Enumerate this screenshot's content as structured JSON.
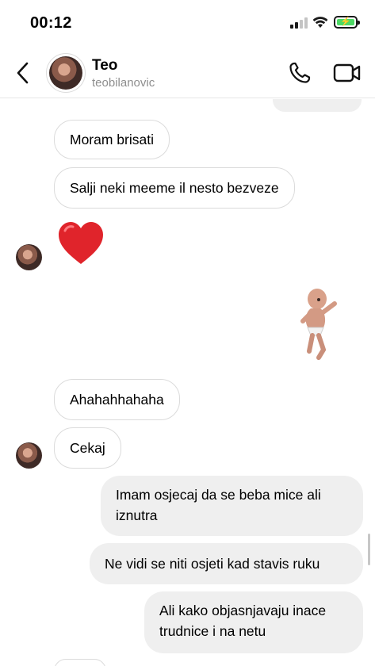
{
  "status_bar": {
    "time": "00:12"
  },
  "header": {
    "name": "Teo",
    "username": "teobilanovic"
  },
  "messages": {
    "m1": "Moram brisati",
    "m2": "Salji neki meeme il nesto bezveze",
    "m3_emoji": "❤️",
    "m4": "Ahahahhahaha",
    "m5": "Cekaj",
    "m6": "Imam osjecaj da se beba mice ali iznutra",
    "m7": "Ne vidi se niti osjeti kad stavis ruku",
    "m8": "Ali kako objasnjavaju inace trudnice i na netu"
  },
  "colors": {
    "incoming_border": "#dbdbdb",
    "outgoing_bg": "#efefef",
    "heart": "#e0242b",
    "battery": "#4cd964"
  }
}
